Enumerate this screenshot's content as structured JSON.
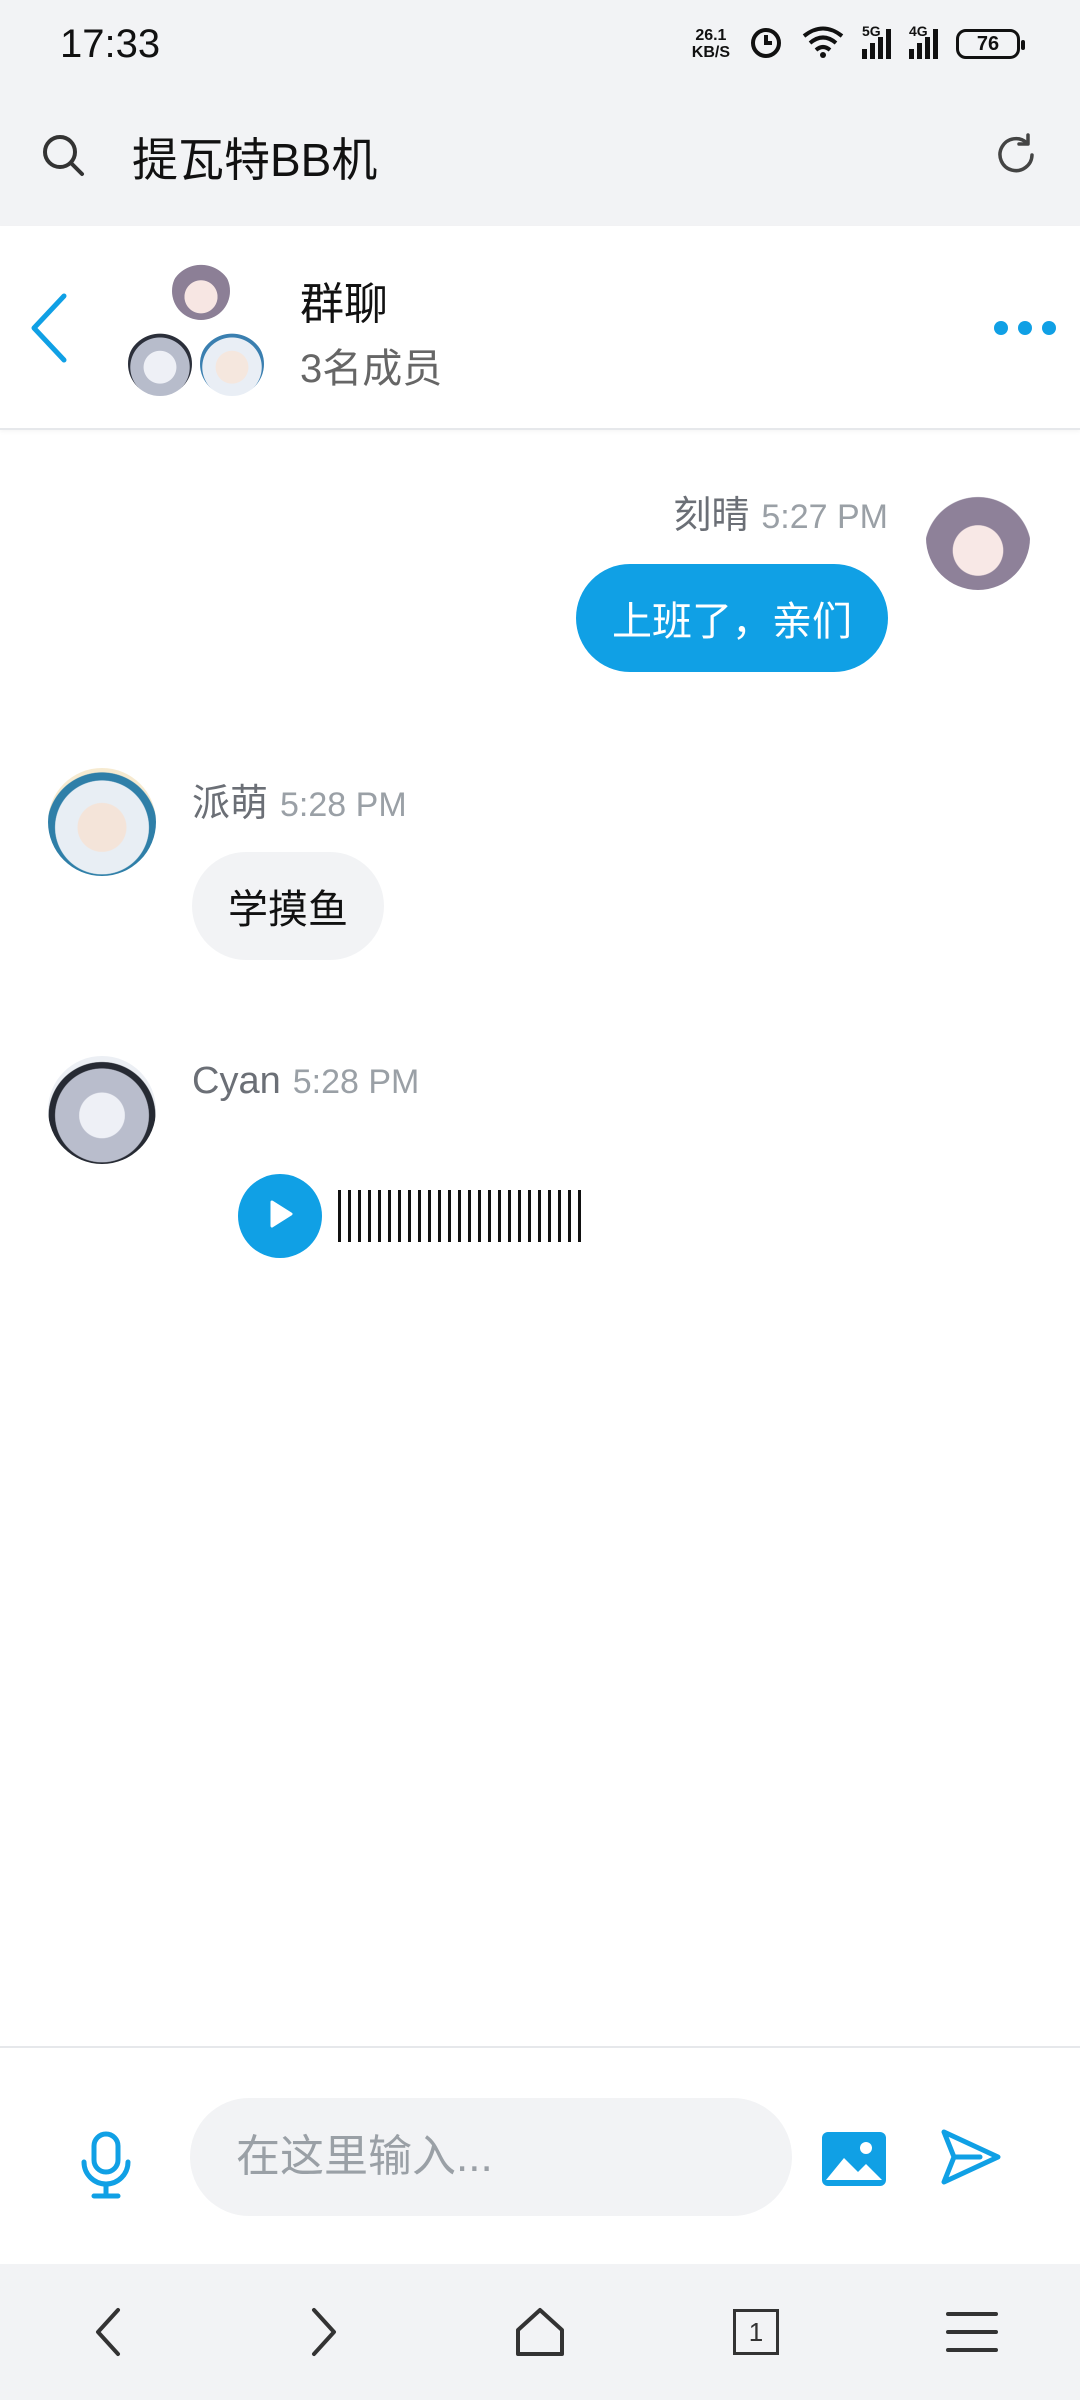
{
  "status_bar": {
    "time": "17:33",
    "net_speed_value": "26.1",
    "net_speed_unit": "KB/S",
    "signal1_label": "5G",
    "signal2_label": "4G",
    "battery": "76"
  },
  "browser": {
    "title": "提瓦特BB机"
  },
  "chat_header": {
    "title": "群聊",
    "subtitle": "3名成员"
  },
  "messages": [
    {
      "sender": "刻晴",
      "time": "5:27 PM",
      "type": "text",
      "text": "上班了，亲们",
      "side": "right"
    },
    {
      "sender": "派萌",
      "time": "5:28 PM",
      "type": "text",
      "text": "学摸鱼",
      "side": "left"
    },
    {
      "sender": "Cyan",
      "time": "5:28 PM",
      "type": "voice",
      "side": "left"
    }
  ],
  "input": {
    "placeholder": "在这里输入..."
  },
  "nav": {
    "tab_count": "1"
  },
  "colors": {
    "accent": "#10a0e5",
    "bubble_grey": "#f2f3f5",
    "bar_bg": "#f2f3f5"
  }
}
